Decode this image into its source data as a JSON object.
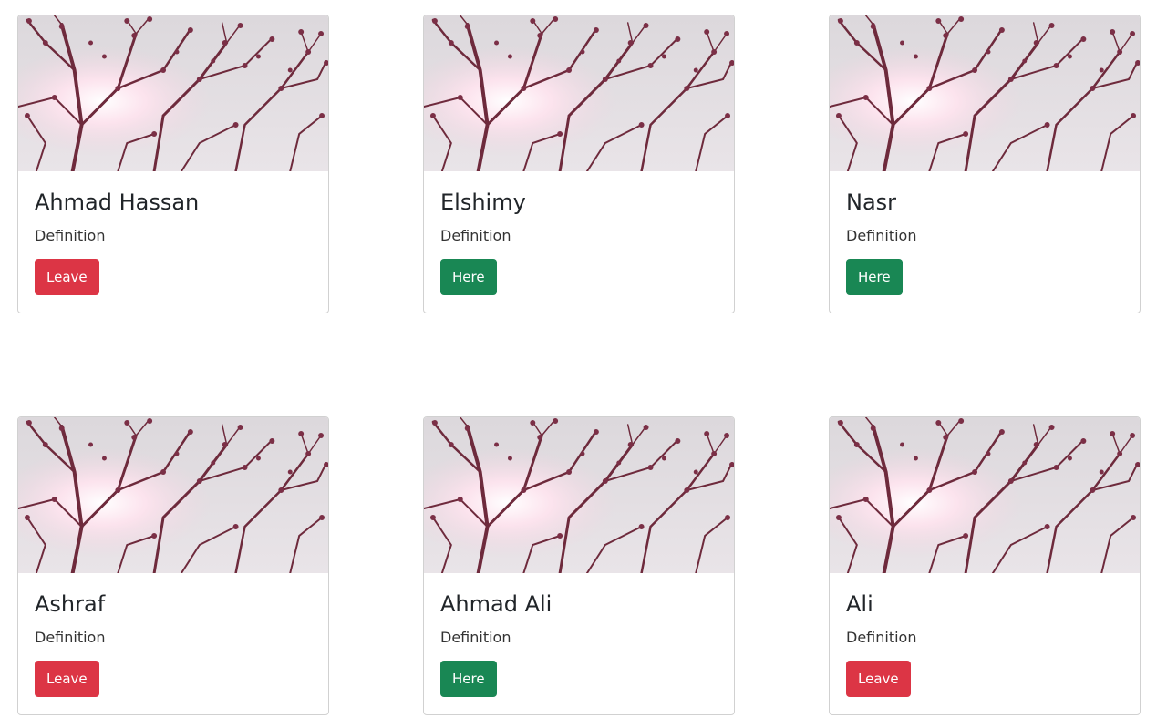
{
  "cards": [
    {
      "name": "Ahmad Hassan",
      "text": "Definition",
      "button_label": "Leave",
      "status": "present"
    },
    {
      "name": "Elshimy",
      "text": "Definition",
      "button_label": "Here",
      "status": "absent"
    },
    {
      "name": "Nasr",
      "text": "Definition",
      "button_label": "Here",
      "status": "absent"
    },
    {
      "name": "Ashraf",
      "text": "Definition",
      "button_label": "Leave",
      "status": "present"
    },
    {
      "name": "Ahmad Ali",
      "text": "Definition",
      "button_label": "Here",
      "status": "absent"
    },
    {
      "name": "Ali",
      "text": "Definition",
      "button_label": "Leave",
      "status": "present"
    }
  ],
  "colors": {
    "present_bg": "#8eed8e",
    "absent_bg": "#808080",
    "leave_button": "#dc3545",
    "here_button": "#198754"
  },
  "image": {
    "subject": "blossoming-tree-branches-photo"
  }
}
